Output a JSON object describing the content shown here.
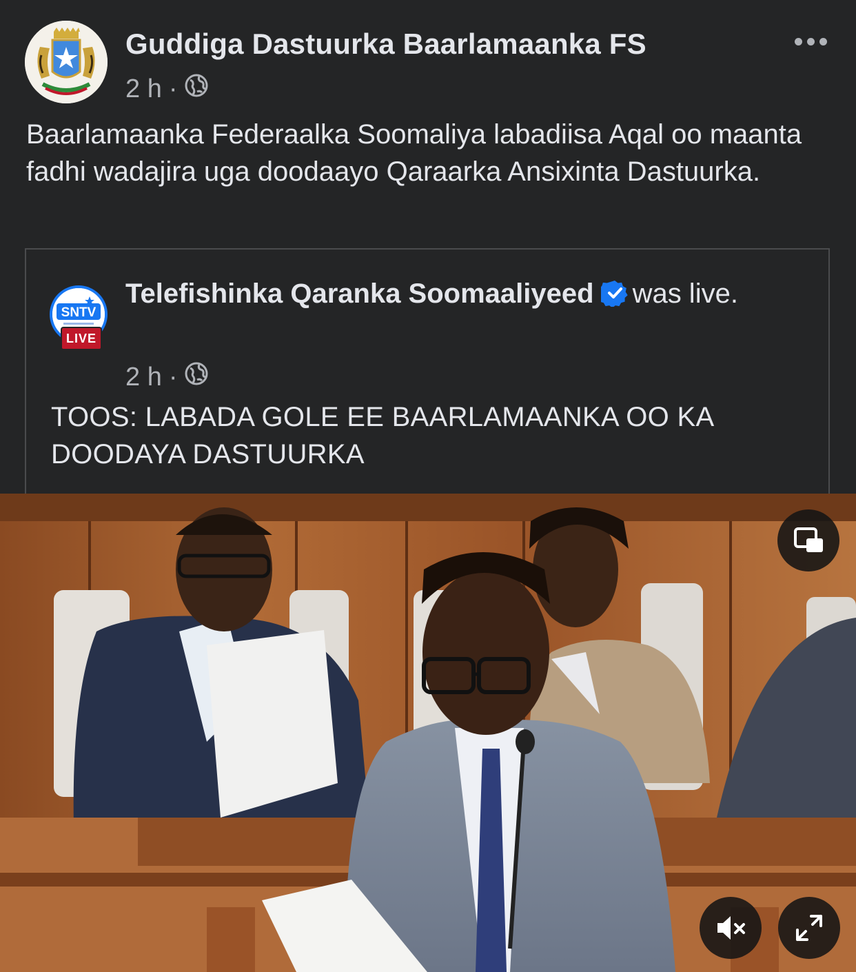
{
  "post": {
    "page_name": "Guddiga Dastuurka Baarlamaanka FS",
    "time": "2 h",
    "separator": "·",
    "caption": "Baarlamaanka Federaalka Soomaliya labadiisa Aqal oo maanta fadhi wadajira uga doodaayo Qaraarka Ansixinta Dastuurka."
  },
  "shared": {
    "page_name": "Telefishinka Qaranka Soomaaliyeed",
    "status_text": "was live.",
    "logo_text": "SNTV",
    "live_badge": "LIVE",
    "time": "2 h",
    "separator": "·",
    "text": "TOOS: LABADA GOLE EE BAARLAMAANKA OO KA DOODAYA DASTUURKA"
  },
  "icons": {
    "more": "more-horizontal-icon",
    "privacy": "globe-icon",
    "verified": "verified-badge-icon",
    "pip": "picture-in-picture-icon",
    "mute": "muted-speaker-icon",
    "fullscreen": "expand-icon"
  },
  "colors": {
    "background": "#242526",
    "text_primary": "#e4e6eb",
    "text_secondary": "#b0b3b8",
    "verified": "#1877f2",
    "live": "#c0182a"
  }
}
